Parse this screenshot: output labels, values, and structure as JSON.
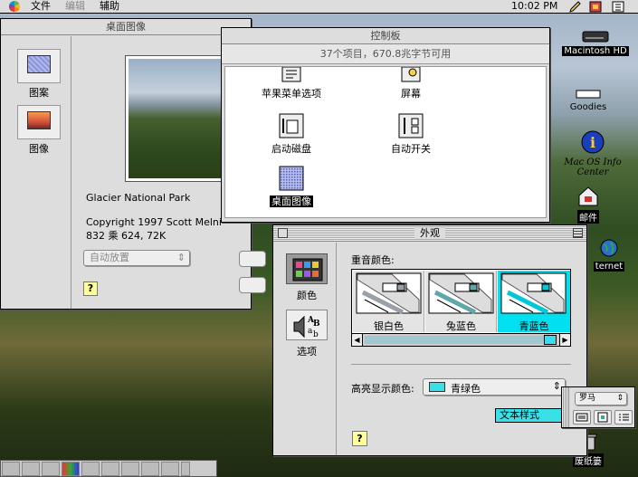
{
  "menubar": {
    "file": "文件",
    "edit": "编辑",
    "help": "辅助",
    "clock": "10:02 PM"
  },
  "desktop_window": {
    "title": "桌面图像",
    "side_items": [
      {
        "label": "图案"
      },
      {
        "label": "图像"
      }
    ],
    "image_name": "Glacier National Park",
    "copyright": "Copyright 1997 Scott Melni",
    "dims": "832 乘 624, 72K",
    "position_popup": "自动放置",
    "help": "?"
  },
  "control_panels": {
    "title": "控制板",
    "status": "37个项目，670.8兆字节可用",
    "items": [
      {
        "label": "苹果菜单选项"
      },
      {
        "label": "屏幕"
      },
      {
        "label": "启动磁盘"
      },
      {
        "label": "自动开关"
      },
      {
        "label": "桌面图像"
      }
    ]
  },
  "appearance": {
    "title": "外观",
    "tabs": [
      {
        "label": "颜色"
      },
      {
        "label": "选项"
      }
    ],
    "accent_label": "重音颜色:",
    "swatches": [
      {
        "label": "银白色",
        "color": "#9aa0a8"
      },
      {
        "label": "兔蓝色",
        "color": "#5fa7a8"
      },
      {
        "label": "青蓝色",
        "color": "#00c8d8"
      }
    ],
    "highlight_label": "高亮显示颜色:",
    "highlight_value": "青绿色",
    "highlight_color": "#3ae0e8",
    "text_style": "文本样式",
    "help": "?"
  },
  "font_palette": {
    "value": "罗马"
  },
  "desktop_icons": {
    "hd": "Macintosh HD",
    "goodies": "Goodies",
    "info": "Mac OS Info Center",
    "mail": "邮件",
    "internet": "ternet",
    "trash": "废纸篓"
  },
  "colors": {
    "menubar": "#dddddd",
    "window": "#dddddd",
    "accent": "#00c8d8"
  }
}
